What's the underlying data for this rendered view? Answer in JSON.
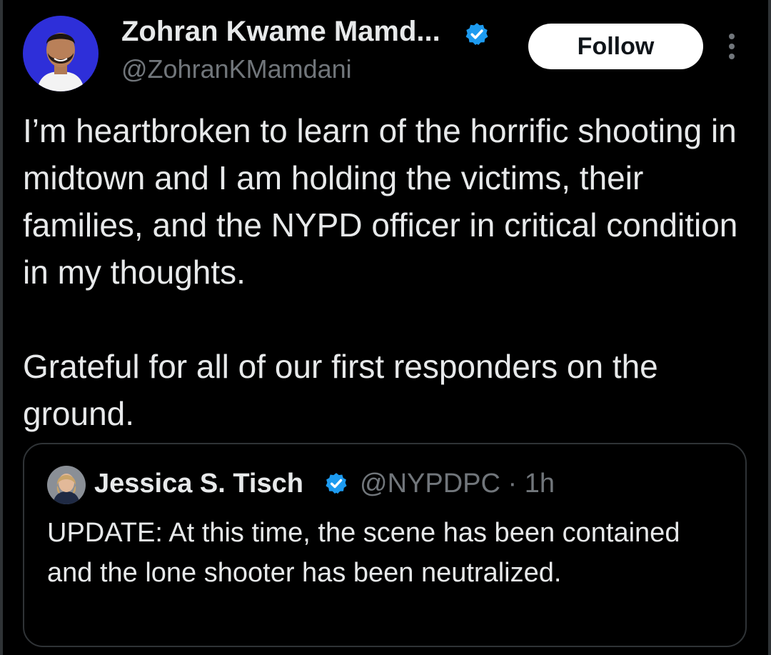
{
  "author": {
    "display_name": "Zohran Kwame Mamd...",
    "handle": "@ZohranKMamdani",
    "avatar_icon": "profile-photo-avatar",
    "verified_icon": "verified-badge-icon"
  },
  "actions": {
    "follow_label": "Follow",
    "more_icon": "more-vertical-icon"
  },
  "tweet": {
    "paragraph1": "I’m heartbroken to learn of the horrific shooting in midtown and I am holding the victims, their families, and the NYPD officer in critical condition in my thoughts.",
    "paragraph2": "Grateful for all of our first responders on the ground."
  },
  "quoted": {
    "display_name": "Jessica S. Tisch",
    "handle": "@NYPDPC",
    "separator": "·",
    "time": "1h",
    "text": "UPDATE: At this time, the scene has been contained and the lone shooter has been neutralized."
  },
  "colors": {
    "background": "#000000",
    "text_primary": "#e7e9ea",
    "text_secondary": "#71767b",
    "verified_blue": "#1d9bf0",
    "border": "#2f3336",
    "follow_bg": "#ffffff"
  }
}
